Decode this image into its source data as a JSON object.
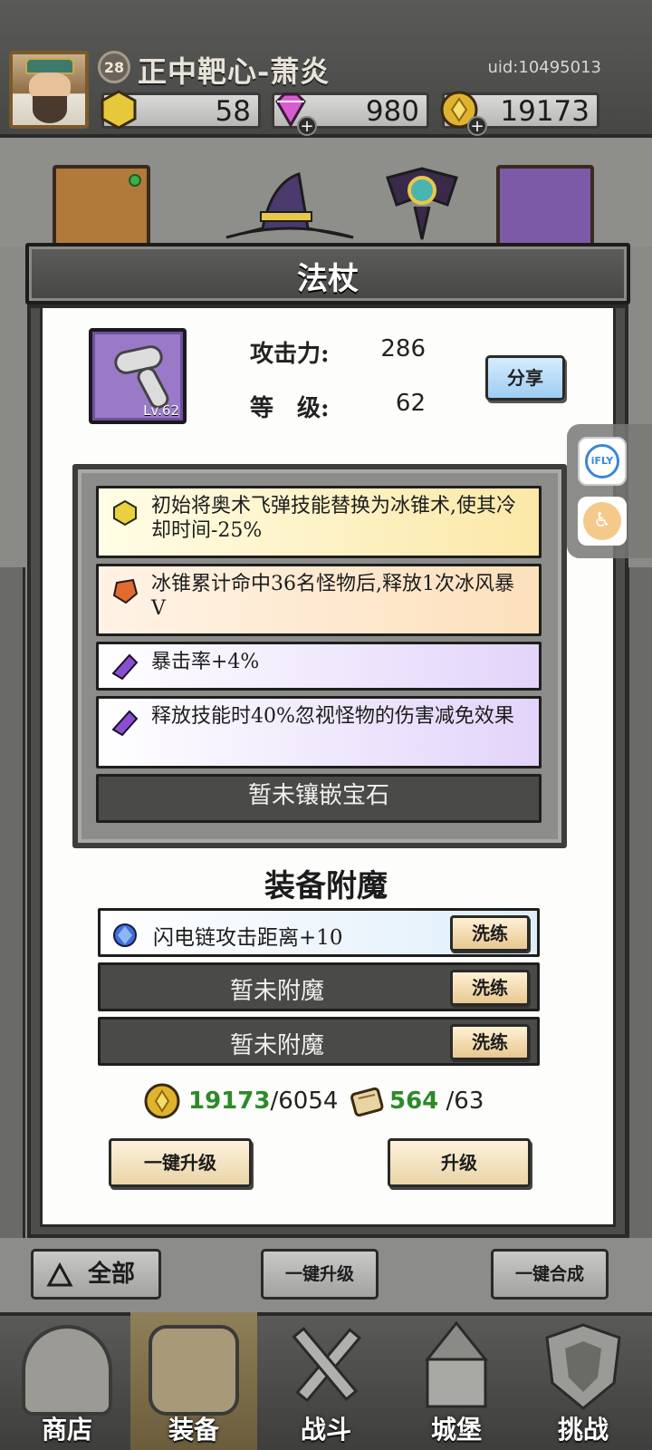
{
  "player": {
    "level": "28",
    "name": "正中靶心-萧炎",
    "uid": "uid:10495013"
  },
  "resources": [
    {
      "name": "gold-hex",
      "value": "58",
      "color": "#e6c83a"
    },
    {
      "name": "diamond",
      "value": "980",
      "color": "#d65ccf"
    },
    {
      "name": "coin",
      "value": "19173",
      "color": "#e0b32e"
    }
  ],
  "modal": {
    "title": "法杖",
    "item_level": "Lv.62",
    "stats": [
      {
        "label": "攻击力:",
        "value": "286"
      },
      {
        "label": "等　级:",
        "value": "62"
      }
    ],
    "share_label": "分享"
  },
  "gems": [
    {
      "icon": "yellow-gem",
      "color": "#e8d040",
      "bg": "linear-gradient(90deg,#fffde6,#fbe8a8)",
      "text": "初始将奥术飞弹技能替换为冰锥术,使其冷却时间-25%"
    },
    {
      "icon": "orange-gem",
      "color": "#e06a30",
      "bg": "linear-gradient(90deg,#fff3e6,#fde0bc)",
      "text": "冰锥累计命中36名怪物后,释放1次冰风暴V"
    },
    {
      "icon": "purple-gem",
      "color": "#8a4fd0",
      "bg": "linear-gradient(90deg,#ffffff,#e2d4fa)",
      "text": "暴击率+4%"
    },
    {
      "icon": "purple-gem",
      "color": "#8a4fd0",
      "bg": "linear-gradient(90deg,#ffffff,#e2d4fa)",
      "text": "释放技能时40%忽视怪物的伤害减免效果"
    }
  ],
  "empty_gem_text": "暂未镶嵌宝石",
  "enchant": {
    "title": "装备附魔",
    "rows": [
      {
        "text": "闪电链攻击距离+10",
        "filled": true
      },
      {
        "text": "暂未附魔",
        "filled": false
      },
      {
        "text": "暂未附魔",
        "filled": false
      }
    ],
    "wash_label": "洗练"
  },
  "cost": {
    "coin_have": "19173",
    "coin_need": "/6054",
    "scroll_have": "564",
    "scroll_need": " /63"
  },
  "actions": {
    "upgrade_all": "一键升级",
    "upgrade": "升级"
  },
  "bottom_controls": {
    "filter": "全部",
    "upgrade_all": "一键升级",
    "merge_all": "一键合成"
  },
  "side_widget": {
    "ifly": "iFLY",
    "access": "♿"
  },
  "nav": [
    {
      "label": "商店",
      "active": false
    },
    {
      "label": "装备",
      "active": true
    },
    {
      "label": "战斗",
      "active": false
    },
    {
      "label": "城堡",
      "active": false
    },
    {
      "label": "挑战",
      "active": false
    }
  ]
}
